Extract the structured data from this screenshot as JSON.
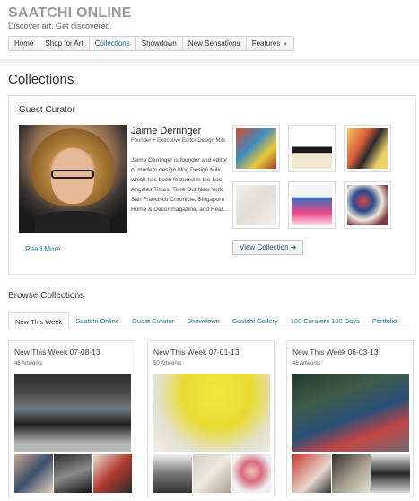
{
  "header": {
    "brand": "SAATCHI ONLINE",
    "tagline": "Discover art. Get discovered."
  },
  "nav": {
    "items": [
      {
        "label": "Home"
      },
      {
        "label": "Shop for Art"
      },
      {
        "label": "Collections",
        "active": true
      },
      {
        "label": "Showdown"
      },
      {
        "label": "New Sensations"
      },
      {
        "label": "Features",
        "has_dropdown": true
      }
    ]
  },
  "page": {
    "title": "Collections"
  },
  "guest_curator": {
    "heading": "Guest Curator",
    "name": "Jaime Derringer",
    "role": "Founder + Executive Editor Design Milk",
    "bio": "Jaime Derringer is founder and editor of modern design blog Design Milk, which has been featured in the Los Angeles Times, Time Out New York, San Francisco Chronicle, Singapore Home & Decor magazine, and Real...",
    "read_more": "Read More",
    "view_collection": "View Collection",
    "view_collection_icon": "arrow-right-icon"
  },
  "browse": {
    "title": "Browse Collections",
    "tabs": [
      {
        "label": "New This Week",
        "active": true
      },
      {
        "label": "Saatchi Online"
      },
      {
        "label": "Guest Curator"
      },
      {
        "label": "Showdown"
      },
      {
        "label": "Saatchi Gallery"
      },
      {
        "label": "100 Curators 100 Days"
      },
      {
        "label": "Portfolio"
      }
    ],
    "cards": [
      {
        "title": "New This Week 07-08-13",
        "count": "48 Artworks"
      },
      {
        "title": "New This Week 07-01-13",
        "count": "50 Artworks"
      },
      {
        "title": "New This Week 06-03-13",
        "count": "46 Artworks"
      }
    ]
  },
  "colors": {
    "link": "#1f6f9a",
    "brand_gray": "#9a9a9a"
  }
}
